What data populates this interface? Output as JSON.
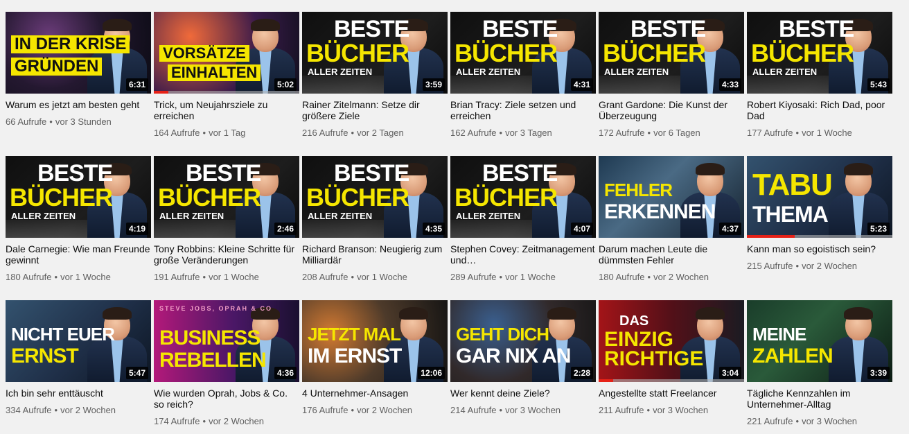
{
  "videos": [
    {
      "title": "Warum es jetzt am besten geht",
      "views": "66 Aufrufe",
      "age": "vor 3 Stunden",
      "duration": "6:31",
      "thumb_text": [
        "IN DER KRISE",
        "GRÜNDEN"
      ],
      "theme": "stage",
      "progress": 0
    },
    {
      "title": "Trick, um Neujahrsziele zu erreichen",
      "views": "164 Aufrufe",
      "age": "vor 1 Tag",
      "duration": "5:02",
      "thumb_text": [
        "VORSÄTZE",
        "EINHALTEN"
      ],
      "theme": "fire",
      "progress": 0.1
    },
    {
      "title": "Rainer Zitelmann: Setze dir größere Ziele",
      "views": "216 Aufrufe",
      "age": "vor 2 Tagen",
      "duration": "3:59",
      "thumb_text": [
        "BESTE",
        "BÜCHER",
        "ALLER ZEITEN"
      ],
      "theme": "book",
      "progress": 0
    },
    {
      "title": "Brian Tracy: Ziele setzen und erreichen",
      "views": "162 Aufrufe",
      "age": "vor 3 Tagen",
      "duration": "4:31",
      "thumb_text": [
        "BESTE",
        "BÜCHER",
        "ALLER ZEITEN"
      ],
      "theme": "book",
      "progress": 0
    },
    {
      "title": "Grant Gardone: Die Kunst der Überzeugung",
      "views": "172 Aufrufe",
      "age": "vor 6 Tagen",
      "duration": "4:33",
      "thumb_text": [
        "BESTE",
        "BÜCHER",
        "ALLER ZEITEN"
      ],
      "theme": "book",
      "progress": 0
    },
    {
      "title": "Robert Kiyosaki: Rich Dad, poor Dad",
      "views": "177 Aufrufe",
      "age": "vor 1 Woche",
      "duration": "5:43",
      "thumb_text": [
        "BESTE",
        "BÜCHER",
        "ALLER ZEITEN"
      ],
      "theme": "book",
      "progress": 0
    },
    {
      "title": "Dale Carnegie: Wie man Freunde gewinnt",
      "views": "180 Aufrufe",
      "age": "vor 1 Woche",
      "duration": "4:19",
      "thumb_text": [
        "BESTE",
        "BÜCHER",
        "ALLER ZEITEN"
      ],
      "theme": "book",
      "progress": 0
    },
    {
      "title": "Tony Robbins: Kleine Schritte für große Veränderungen",
      "views": "191 Aufrufe",
      "age": "vor 1 Woche",
      "duration": "2:46",
      "thumb_text": [
        "BESTE",
        "BÜCHER",
        "ALLER ZEITEN"
      ],
      "theme": "book",
      "progress": 0
    },
    {
      "title": "Richard Branson: Neugierig zum Milliardär",
      "views": "208 Aufrufe",
      "age": "vor 1 Woche",
      "duration": "4:35",
      "thumb_text": [
        "BESTE",
        "BÜCHER",
        "ALLER ZEITEN"
      ],
      "theme": "book",
      "progress": 0
    },
    {
      "title": "Stephen Covey: Zeitmanagement und…",
      "views": "289 Aufrufe",
      "age": "vor 1 Woche",
      "duration": "4:07",
      "thumb_text": [
        "BESTE",
        "BÜCHER",
        "ALLER ZEITEN"
      ],
      "theme": "book",
      "progress": 0
    },
    {
      "title": "Darum machen Leute die dümmsten Fehler",
      "views": "180 Aufrufe",
      "age": "vor 2 Wochen",
      "duration": "4:37",
      "thumb_text": [
        "FEHLER",
        "ERKENNEN"
      ],
      "theme": "wall",
      "progress": 0
    },
    {
      "title": "Kann man so egoistisch sein?",
      "views": "215 Aufrufe",
      "age": "vor 2 Wochen",
      "duration": "5:23",
      "thumb_text": [
        "TABU",
        "THEMA"
      ],
      "theme": "city",
      "progress": 0.33
    },
    {
      "title": "Ich bin sehr enttäuscht",
      "views": "334 Aufrufe",
      "age": "vor 2 Wochen",
      "duration": "5:47",
      "thumb_text": [
        "NICHT EUER",
        "ERNST"
      ],
      "theme": "city",
      "progress": 0
    },
    {
      "title": "Wie wurden Oprah, Jobs & Co. so reich?",
      "views": "174 Aufrufe",
      "age": "vor 2 Wochen",
      "duration": "4:36",
      "thumb_text": [
        "STEVE JOBS, OPRAH & CO",
        "BUSINESS",
        "REBELLEN"
      ],
      "theme": "pink",
      "progress": 0
    },
    {
      "title": "4 Unternehmer-Ansagen",
      "views": "176 Aufrufe",
      "age": "vor 2 Wochen",
      "duration": "12:06",
      "thumb_text": [
        "JETZT MAL",
        "IM ERNST"
      ],
      "theme": "bokeh",
      "progress": 0
    },
    {
      "title": "Wer kennt deine Ziele?",
      "views": "214 Aufrufe",
      "age": "vor 3 Wochen",
      "duration": "2:28",
      "thumb_text": [
        "GEHT DICH",
        "GAR NIX AN"
      ],
      "theme": "bokeh2",
      "progress": 0
    },
    {
      "title": "Angestellte statt Freelancer",
      "views": "211 Aufrufe",
      "age": "vor 3 Wochen",
      "duration": "3:04",
      "thumb_text": [
        "DAS",
        "EINZIG",
        "RICHTIGE"
      ],
      "theme": "red",
      "progress": 0.1
    },
    {
      "title": "Tägliche Kennzahlen im Unternehmer-Alltag",
      "views": "221 Aufrufe",
      "age": "vor 3 Wochen",
      "duration": "3:39",
      "thumb_text": [
        "MEINE",
        "ZAHLEN"
      ],
      "theme": "green",
      "progress": 0
    }
  ],
  "colors": {
    "accent": "#f5e600",
    "progress_red": "#e62117",
    "text": "#0d0d0d",
    "meta": "#606060",
    "background": "#f1f1f1"
  }
}
